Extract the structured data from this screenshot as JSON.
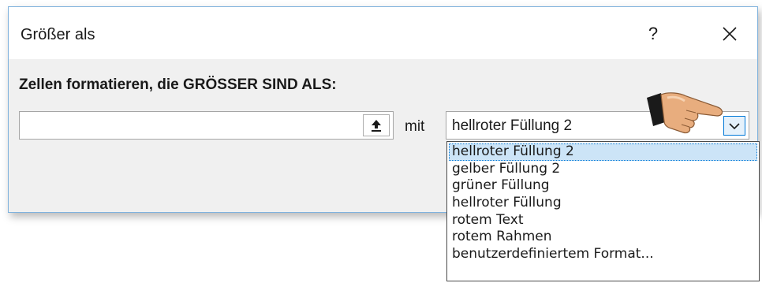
{
  "dialog": {
    "title": "Größer als",
    "help_label": "?",
    "heading": "Zellen formatieren, die GRÖSSER SIND ALS:",
    "value_input": {
      "value": ""
    },
    "mit_label": "mit",
    "format_select": {
      "selected": "hellroter Füllung 2",
      "options": [
        "hellroter Füllung 2",
        "gelber Füllung 2",
        "grüner Füllung",
        "hellroter Füllung",
        "rotem Text",
        "rotem Rahmen",
        "benutzerdefiniertem Format..."
      ]
    }
  },
  "icons": {
    "help": "question-mark-icon",
    "close": "close-icon",
    "range_select": "upload-arrow-icon",
    "dropdown": "chevron-down-icon",
    "pointer": "pointing-hand-icon"
  },
  "colors": {
    "accent": "#0078d7",
    "selected_bg": "#cce4f7",
    "dialog_body": "#f0f0f0",
    "border": "#7fb2dd"
  }
}
